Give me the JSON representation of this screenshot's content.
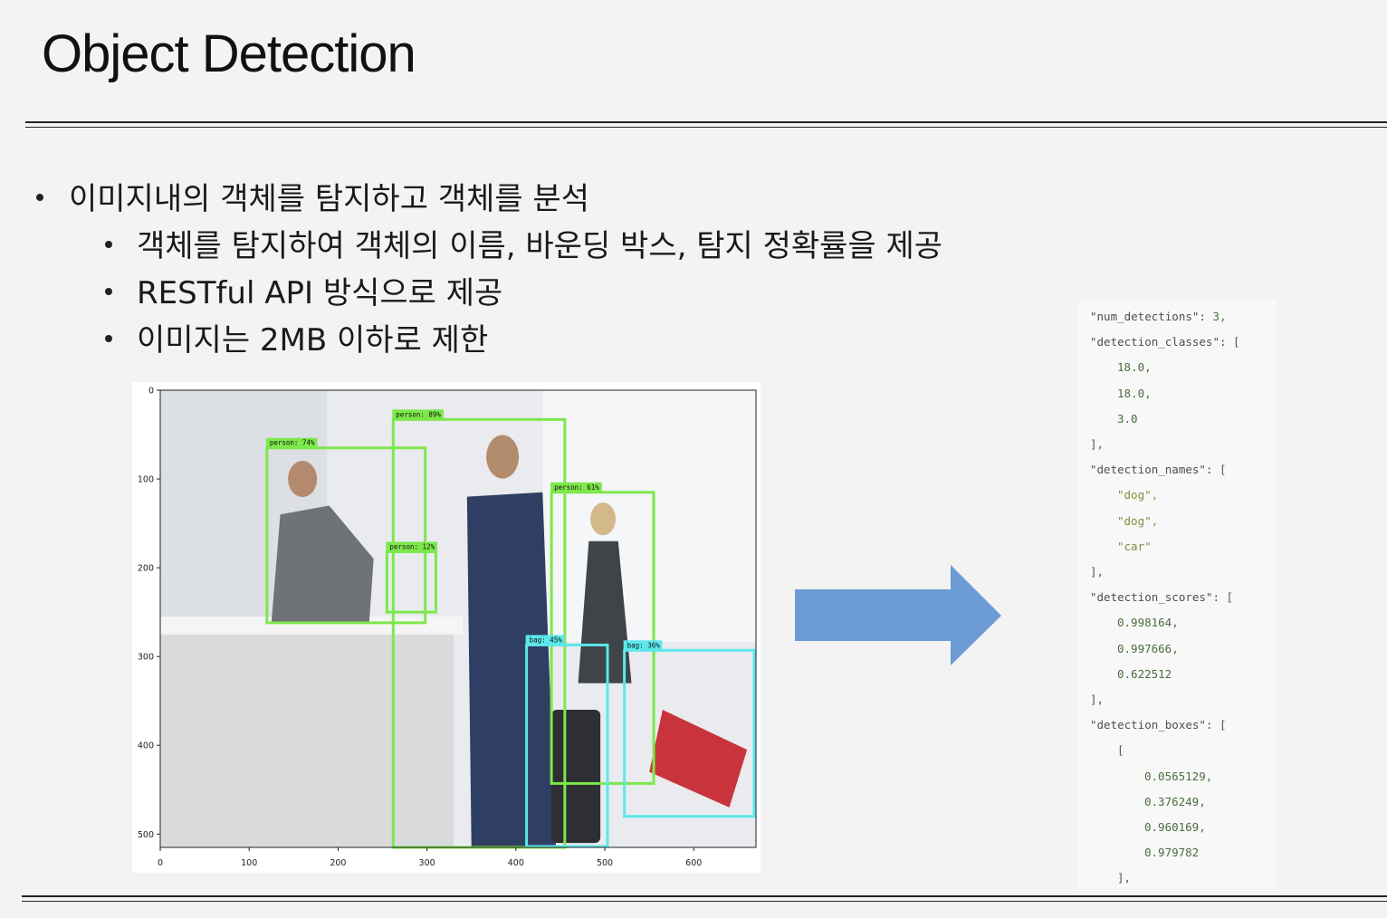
{
  "slide": {
    "title": "Object Detection",
    "bullets": [
      {
        "level": 1,
        "text": "이미지내의 객체를 탐지하고 객체를 분석"
      },
      {
        "level": 2,
        "text": "객체를 탐지하여 객체의 이름, 바운딩 박스, 탐지 정확률을 제공"
      },
      {
        "level": 2,
        "text": "RESTful API 방식으로 제공"
      },
      {
        "level": 2,
        "text": "이미지는 2MB 이하로 제한"
      }
    ]
  },
  "detection_plot": {
    "x_ticks": [
      "0",
      "100",
      "200",
      "300",
      "400",
      "500",
      "600"
    ],
    "y_ticks": [
      "0",
      "100",
      "200",
      "300",
      "400",
      "500"
    ],
    "x_range": [
      0,
      670
    ],
    "y_range": [
      0,
      515
    ],
    "boxes": [
      {
        "label": "person: 74%",
        "color": "#7de84b",
        "x0": 120,
        "y0": 65,
        "x1": 298,
        "y1": 262
      },
      {
        "label": "person: 89%",
        "color": "#7de84b",
        "x0": 262,
        "y0": 33,
        "x1": 455,
        "y1": 515
      },
      {
        "label": "person: 12%",
        "color": "#7de84b",
        "x0": 255,
        "y0": 182,
        "x1": 310,
        "y1": 250
      },
      {
        "label": "person: 61%",
        "color": "#7de84b",
        "x0": 440,
        "y0": 115,
        "x1": 555,
        "y1": 443
      },
      {
        "label": "bag: 45%",
        "color": "#5ce8ea",
        "x0": 412,
        "y0": 287,
        "x1": 503,
        "y1": 514
      },
      {
        "label": "bag: 36%",
        "color": "#5ce8ea",
        "x0": 522,
        "y0": 293,
        "x1": 668,
        "y1": 480
      }
    ]
  },
  "json_response": {
    "lines": [
      {
        "indent": 0,
        "key": "num_detections",
        "value": "3",
        "kind": "num",
        "suffix": ","
      },
      {
        "indent": 0,
        "key": "detection_classes",
        "value": "[",
        "kind": "punct"
      },
      {
        "indent": 1,
        "value": "18.0,",
        "kind": "num"
      },
      {
        "indent": 1,
        "value": "18.0,",
        "kind": "num"
      },
      {
        "indent": 1,
        "value": "3.0",
        "kind": "num"
      },
      {
        "indent": 0,
        "value": "],",
        "kind": "punct"
      },
      {
        "indent": 0,
        "key": "detection_names",
        "value": "[",
        "kind": "punct"
      },
      {
        "indent": 1,
        "value": "\"dog\",",
        "kind": "str"
      },
      {
        "indent": 1,
        "value": "\"dog\",",
        "kind": "str"
      },
      {
        "indent": 1,
        "value": "\"car\"",
        "kind": "str"
      },
      {
        "indent": 0,
        "value": "],",
        "kind": "punct"
      },
      {
        "indent": 0,
        "key": "detection_scores",
        "value": "[",
        "kind": "punct"
      },
      {
        "indent": 1,
        "value": "0.998164,",
        "kind": "num"
      },
      {
        "indent": 1,
        "value": "0.997666,",
        "kind": "num"
      },
      {
        "indent": 1,
        "value": "0.622512",
        "kind": "num"
      },
      {
        "indent": 0,
        "value": "],",
        "kind": "punct"
      },
      {
        "indent": 0,
        "key": "detection_boxes",
        "value": "[",
        "kind": "punct"
      },
      {
        "indent": 1,
        "value": "[",
        "kind": "punct"
      },
      {
        "indent": 2,
        "value": "0.0565129,",
        "kind": "num"
      },
      {
        "indent": 2,
        "value": "0.376249,",
        "kind": "num"
      },
      {
        "indent": 2,
        "value": "0.960169,",
        "kind": "num"
      },
      {
        "indent": 2,
        "value": "0.979782",
        "kind": "num"
      },
      {
        "indent": 1,
        "value": "],",
        "kind": "punct"
      }
    ]
  },
  "colors": {
    "arrow": "#6c9bd3",
    "person_box": "#7de84b",
    "bag_box": "#5ce8ea"
  }
}
